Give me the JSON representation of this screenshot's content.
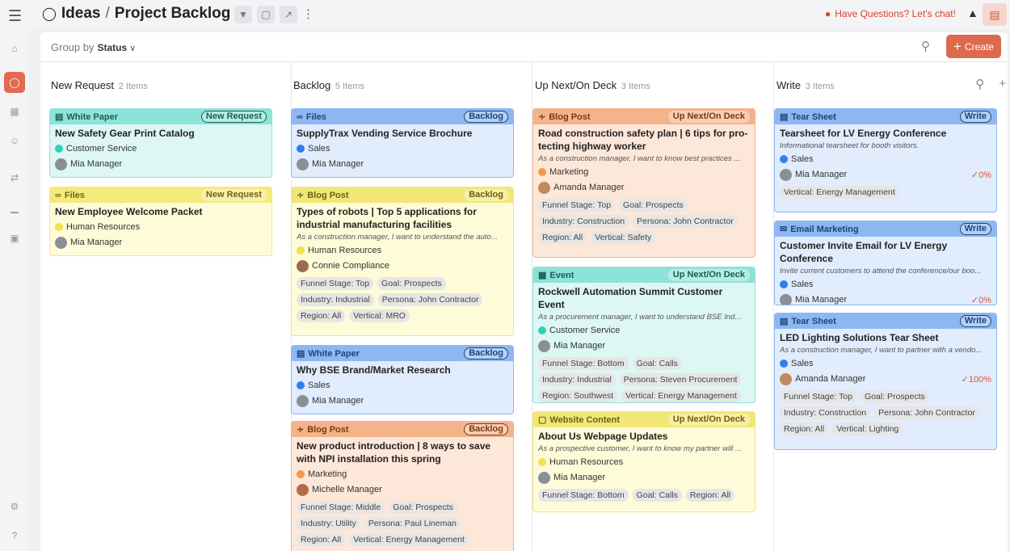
{
  "breadcrumb": {
    "section": "Ideas",
    "separator": "/",
    "board": "Project Backlog"
  },
  "topbar": {
    "chat_text": "Have Questions? Let's chat!"
  },
  "filterbar": {
    "group_by_label": "Group by",
    "group_by_value": "Status",
    "create_label": "Create"
  },
  "columns": [
    {
      "title": "New Request",
      "count": "2 Items",
      "cards": [
        {
          "type": "White Paper",
          "status": "New Request",
          "title": "New Safety Gear Print Catalog",
          "dept": "Customer Service",
          "owner": "Mia Manager"
        },
        {
          "type": "Files",
          "status": "New Request",
          "title": "New Employee Welcome Packet",
          "dept": "Human Resources",
          "owner": "Mia Manager"
        }
      ]
    },
    {
      "title": "Backlog",
      "count": "5 Items",
      "cards": [
        {
          "type": "Files",
          "status": "Backlog",
          "title": "SupplyTrax Vending Service Brochure",
          "dept": "Sales",
          "owner": "Mia Manager"
        },
        {
          "type": "Blog Post",
          "status": "Backlog",
          "title": "Types of robots | Top 5 applications for industrial manufacturing facilities",
          "desc": "As a construction manager, I want to understand the auto...",
          "dept": "Human Resources",
          "owner": "Connie Compliance",
          "tags": [
            "Funnel Stage: Top",
            "Goal: Prospects",
            "Industry: Industrial",
            "Persona: John Contractor",
            "Region: All",
            "Vertical: MRO"
          ]
        },
        {
          "type": "White Paper",
          "status": "Backlog",
          "title": "Why BSE Brand/Market Research",
          "dept": "Sales",
          "owner": "Mia Manager"
        },
        {
          "type": "Blog Post",
          "status": "Backlog",
          "title": "New product introduction | 8 ways to save with NPI installation this spring",
          "dept": "Marketing",
          "owner": "Michelle Manager",
          "tags": [
            "Funnel Stage: Middle",
            "Goal: Prospects",
            "Industry: Utility",
            "Persona: Paul Lineman",
            "Region: All",
            "Vertical: Energy Management"
          ]
        }
      ]
    },
    {
      "title": "Up Next/On Deck",
      "count": "3 Items",
      "cards": [
        {
          "type": "Blog Post",
          "status": "Up Next/On Deck",
          "title": "Road construction safety plan | 6 tips for pro-tecting highway worker",
          "desc": "As a construction manager, I want to know best practices ...",
          "dept": "Marketing",
          "owner": "Amanda Manager",
          "tags": [
            "Funnel Stage: Top",
            "Goal: Prospects",
            "Industry: Construction",
            "Persona: John Contractor",
            "Region: All",
            "Vertical: Safety"
          ]
        },
        {
          "type": "Event",
          "status": "Up Next/On Deck",
          "title": "Rockwell Automation Summit Customer Event",
          "desc": "As a procurement manager, I want to understand BSE Ind...",
          "dept": "Customer Service",
          "owner": "Mia Manager",
          "tags": [
            "Funnel Stage: Bottom",
            "Goal: Calls",
            "Industry: Industrial",
            "Persona: Steven Procurement",
            "Region: Southwest",
            "Vertical: Energy Management"
          ]
        },
        {
          "type": "Website Content",
          "status": "Up Next/On Deck",
          "title": "About Us Webpage Updates",
          "desc": "As a prospective customer, I want to know my partner will ...",
          "dept": "Human Resources",
          "owner": "Mia Manager",
          "tags": [
            "Funnel Stage: Bottom",
            "Goal: Calls",
            "Region: All"
          ]
        }
      ]
    },
    {
      "title": "Write",
      "count": "3 Items",
      "cards": [
        {
          "type": "Tear Sheet",
          "status": "Write",
          "title": "Tearsheet for LV Energy Conference",
          "desc": "Informational tearsheet for booth visitors.",
          "dept": "Sales",
          "owner": "Mia Manager",
          "progress": "0%",
          "tags": [
            "Vertical: Energy Management"
          ]
        },
        {
          "type": "Email Marketing",
          "status": "Write",
          "title": "Customer Invite Email for LV Energy Conference",
          "desc": "Invite current customers to attend the conference/our boo...",
          "dept": "Sales",
          "owner": "Mia Manager",
          "progress": "0%"
        },
        {
          "type": "Tear Sheet",
          "status": "Write",
          "title": "LED Lighting Solutions Tear Sheet",
          "desc": "As a construction manager, I want to partner with a vendo...",
          "dept": "Sales",
          "owner": "Amanda Manager",
          "progress": "100%",
          "tags": [
            "Funnel Stage: Top",
            "Goal: Prospects",
            "Industry: Construction",
            "Persona: John Contractor",
            "Region: All",
            "Vertical: Lighting"
          ]
        }
      ]
    }
  ],
  "colors": {
    "accent": "#dd6a4d",
    "sales": "#2f80ed",
    "marketing": "#f2994a",
    "customer_service": "#2ed3b7",
    "human_resources": "#f2e14c"
  }
}
